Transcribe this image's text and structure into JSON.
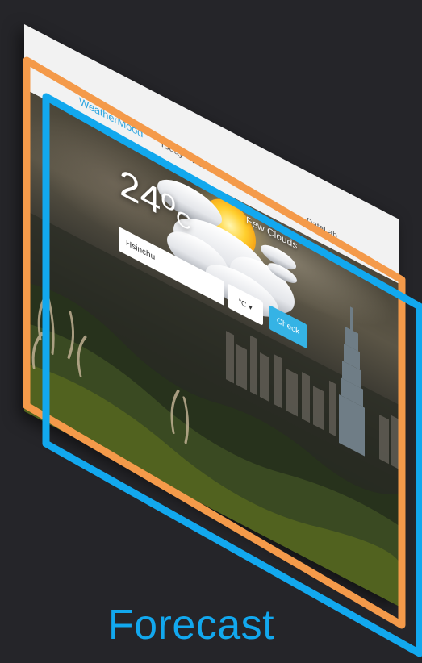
{
  "app": {
    "brand": "WeatherMood",
    "nav": [
      {
        "label": "Today"
      },
      {
        "label": "Forecast"
      }
    ],
    "nav_right": "DataLab"
  },
  "weather": {
    "temperature": "24",
    "degree_symbol": "o",
    "unit_letter": "C",
    "condition": "Few Clouds",
    "icon": "sun-behind-cloud-icon"
  },
  "form": {
    "city_value": "Hsinchu",
    "unit_selected": "°C ▾",
    "check_label": "Check"
  },
  "caption": "Forecast",
  "colors": {
    "brand_blue": "#31a7e0",
    "check_button": "#35b3e5",
    "orange_frame": "#f49a4a",
    "blue_frame": "#12a8ee",
    "background": "#252529"
  }
}
